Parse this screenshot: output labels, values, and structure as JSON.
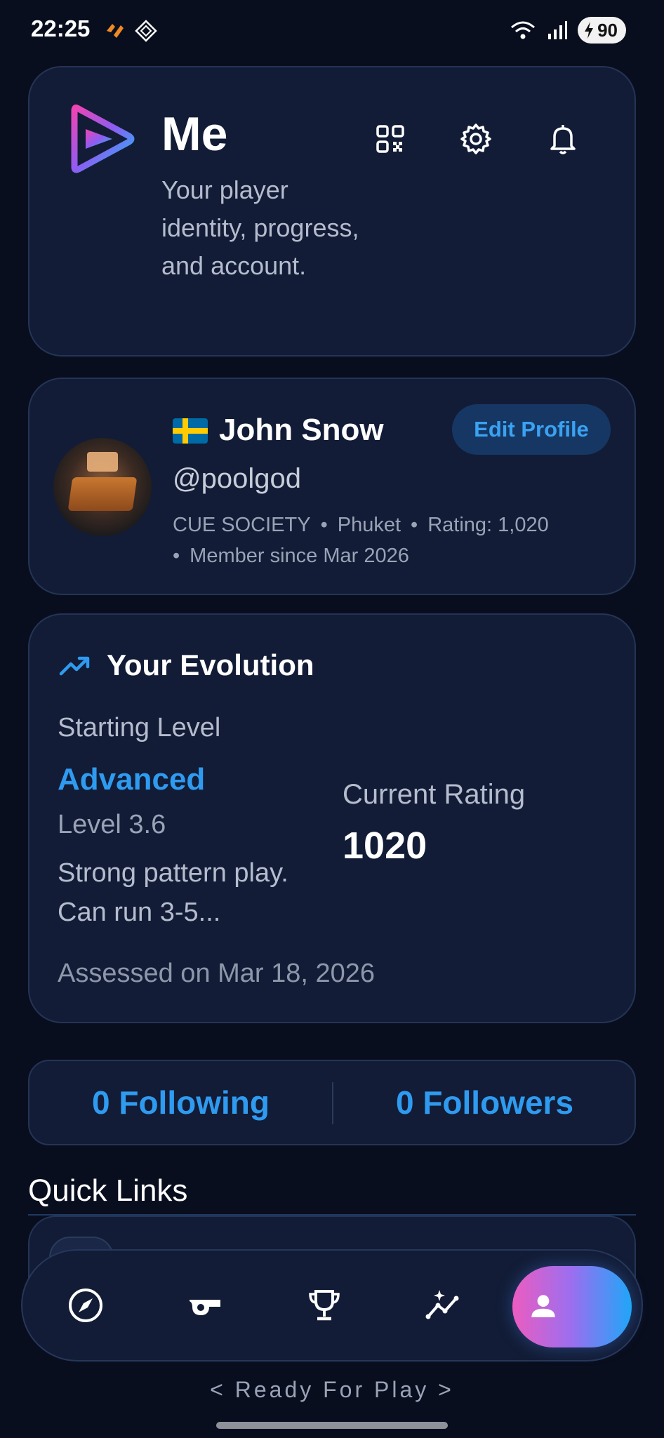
{
  "status_bar": {
    "time": "22:25",
    "battery": "90"
  },
  "header": {
    "title": "Me",
    "subtitle": "Your player identity, progress, and account."
  },
  "profile": {
    "name": "John Snow",
    "handle": "@poolgod",
    "edit_label": "Edit Profile",
    "club": "CUE SOCIETY",
    "location": "Phuket",
    "rating_text": "Rating: 1,020",
    "member_since": "Member since Mar 2026",
    "dot": "•"
  },
  "evolution": {
    "title": "Your Evolution",
    "starting_label": "Starting Level",
    "level_name": "Advanced",
    "level_number": "Level 3.6",
    "level_description": "Strong pattern play. Can run 3-5...",
    "current_label": "Current Rating",
    "current_value": "1020",
    "assessed": "Assessed on Mar 18, 2026"
  },
  "social": {
    "following": "0 Following",
    "followers": "0 Followers"
  },
  "quick_links": {
    "title": "Quick Links"
  },
  "nav": {
    "items": [
      "compass-icon",
      "whistle-icon",
      "trophy-icon",
      "sparkle-chart-icon",
      "profile-icon"
    ],
    "active": "profile-icon"
  },
  "footer": {
    "tagline": "< Ready For Play >"
  },
  "colors": {
    "background": "#090e1e",
    "card": "#121c36",
    "accent": "#2f9bf0"
  }
}
